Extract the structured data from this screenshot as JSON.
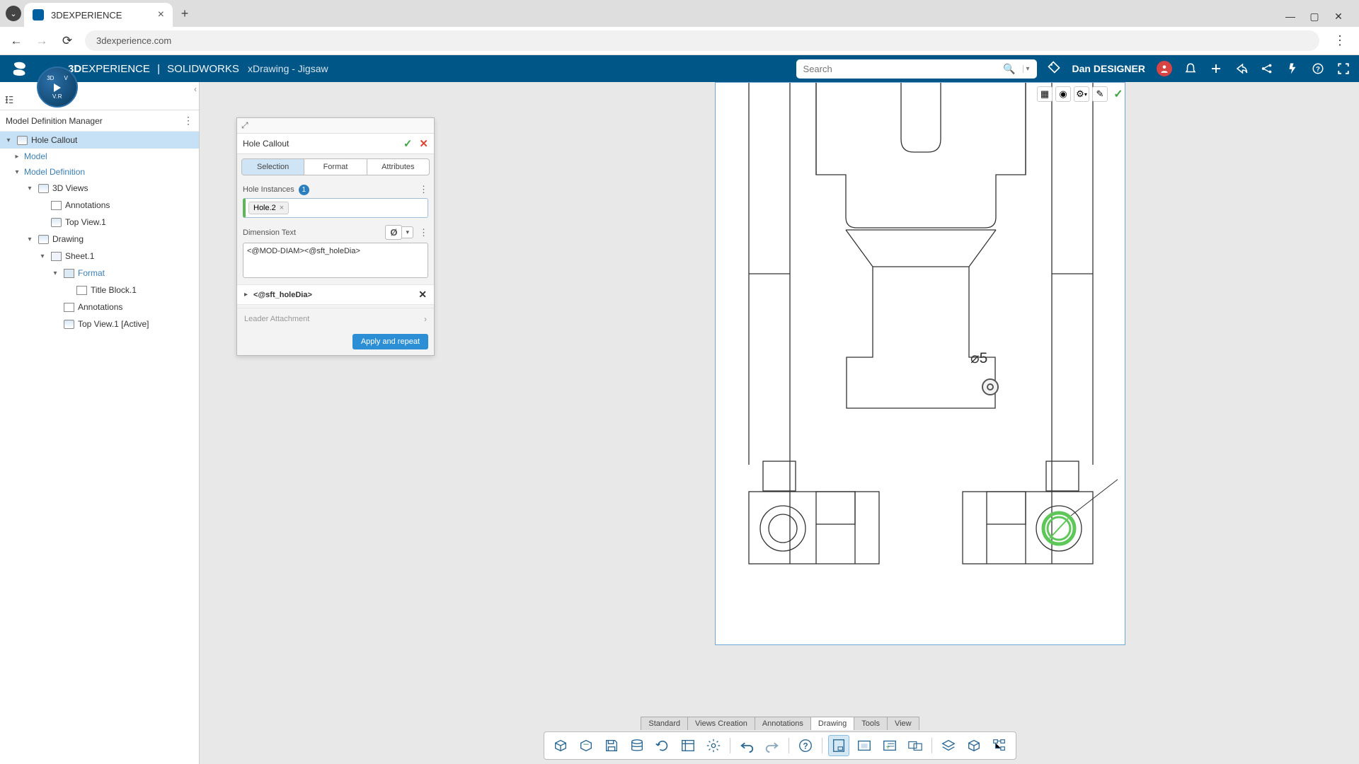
{
  "browser": {
    "tab_title": "3DEXPERIENCE",
    "url": "3dexperience.com"
  },
  "header": {
    "brand_bold": "3D",
    "brand_rest": "EXPERIENCE",
    "brand_sep": "|",
    "brand_app": "SOLIDWORKS",
    "context": "xDrawing - Jigsaw",
    "search_placeholder": "Search",
    "user": "Dan DESIGNER"
  },
  "compass": {
    "tl": "3D",
    "tr": "V",
    "bottom": "V.R"
  },
  "left_panel": {
    "title": "Model Definition Manager",
    "tree": {
      "root": "Hole Callout",
      "model": "Model",
      "model_def": "Model Definition",
      "views3d": "3D Views",
      "annotations1": "Annotations",
      "topview1": "Top View.1",
      "drawing": "Drawing",
      "sheet1": "Sheet.1",
      "format": "Format",
      "titleblock": "Title Block.1",
      "annotations2": "Annotations",
      "topview_active": "Top View.1 [Active]"
    }
  },
  "prop": {
    "title": "Hole Callout",
    "tab_selection": "Selection",
    "tab_format": "Format",
    "tab_attributes": "Attributes",
    "hole_instances": "Hole Instances",
    "hole_count": "1",
    "chip": "Hole.2",
    "dim_text_label": "Dimension Text",
    "dim_sym": "Ø",
    "text_value": "<@MOD-DIAM><@sft_holeDia>",
    "var_row": "<@sft_holeDia>",
    "leader": "Leader Attachment",
    "apply": "Apply and repeat"
  },
  "callout": {
    "text": "⌀5"
  },
  "bottom_tabs": {
    "standard": "Standard",
    "views": "Views Creation",
    "annotations": "Annotations",
    "drawing": "Drawing",
    "tools": "Tools",
    "view": "View"
  }
}
